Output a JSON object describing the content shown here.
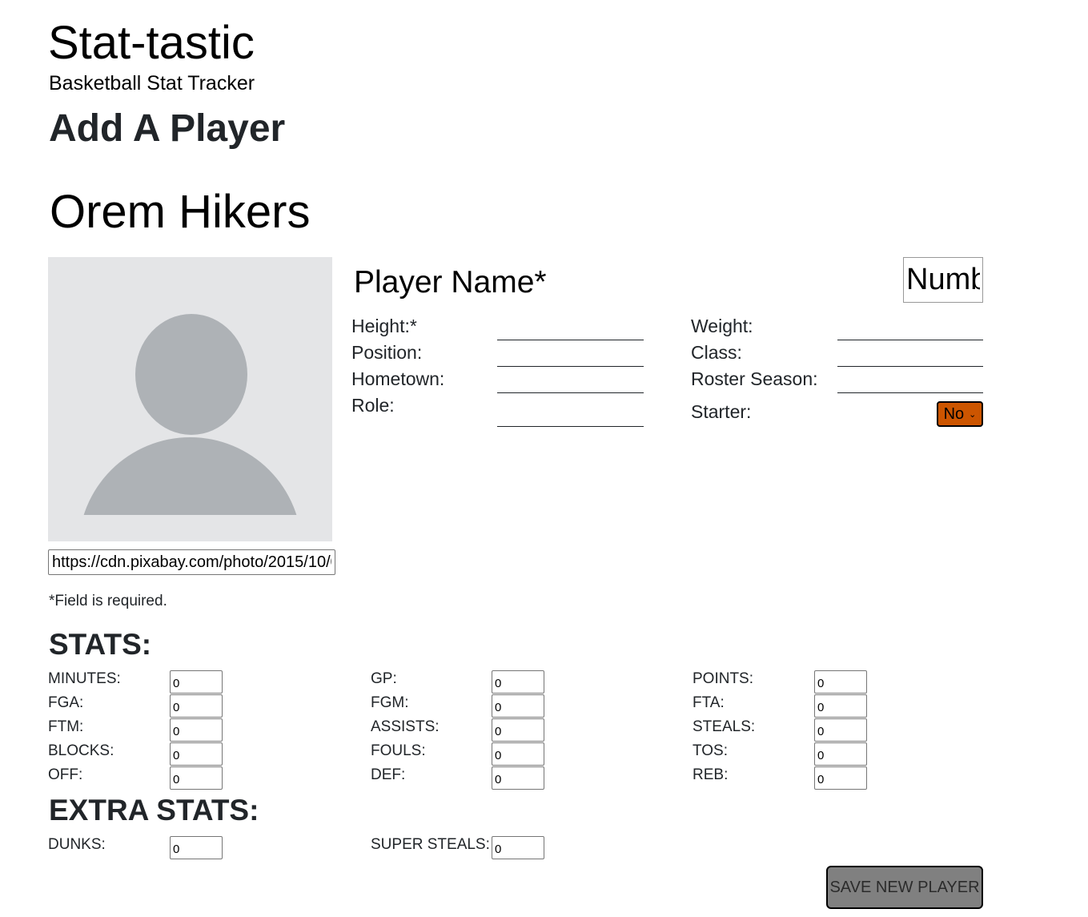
{
  "header": {
    "title": "Stat-tastic",
    "subtitle": "Basketball Stat Tracker"
  },
  "page_heading": "Add A Player",
  "team_name": "Orem Hikers",
  "player": {
    "photo_url": "https://cdn.pixabay.com/photo/2015/10/05/22/37/blank-profile-picture-973460_960_720.png",
    "name_placeholder": "Player Name*",
    "number_placeholder": "Number"
  },
  "fields": {
    "height_label": "Height:*",
    "position_label": "Position:",
    "hometown_label": "Hometown:",
    "role_label": "Role:",
    "weight_label": "Weight:",
    "class_label": "Class:",
    "roster_season_label": "Roster Season:",
    "starter_label": "Starter:",
    "starter_value": "No"
  },
  "required_note": "*Field is required.",
  "stats": {
    "heading": "STATS:",
    "rows": [
      [
        {
          "label": "MINUTES:",
          "value": "0"
        },
        {
          "label": "GP:",
          "value": "0"
        },
        {
          "label": "POINTS:",
          "value": "0"
        }
      ],
      [
        {
          "label": "FGA:",
          "value": "0"
        },
        {
          "label": "FGM:",
          "value": "0"
        },
        {
          "label": "FTA:",
          "value": "0"
        }
      ],
      [
        {
          "label": "FTM:",
          "value": "0"
        },
        {
          "label": "ASSISTS:",
          "value": "0"
        },
        {
          "label": "STEALS:",
          "value": "0"
        }
      ],
      [
        {
          "label": "BLOCKS:",
          "value": "0"
        },
        {
          "label": "FOULS:",
          "value": "0"
        },
        {
          "label": "TOS:",
          "value": "0"
        }
      ],
      [
        {
          "label": "OFF:",
          "value": "0"
        },
        {
          "label": "DEF:",
          "value": "0"
        },
        {
          "label": "REB:",
          "value": "0"
        }
      ]
    ]
  },
  "extra_stats": {
    "heading": "EXTRA STATS:",
    "items": [
      {
        "label": "DUNKS:",
        "value": "0"
      },
      {
        "label": "SUPER STEALS:",
        "value": "0"
      }
    ]
  },
  "actions": {
    "save_label": "SAVE NEW PLAYER"
  },
  "colors": {
    "starter_select_bg": "#cc5500",
    "save_button_bg": "#808080",
    "photo_bg": "#e4e5e7",
    "avatar_fill": "#aeb2b6"
  },
  "icons": {
    "avatar": "person-silhouette-icon",
    "select_chevron": "chevron-down-icon"
  }
}
